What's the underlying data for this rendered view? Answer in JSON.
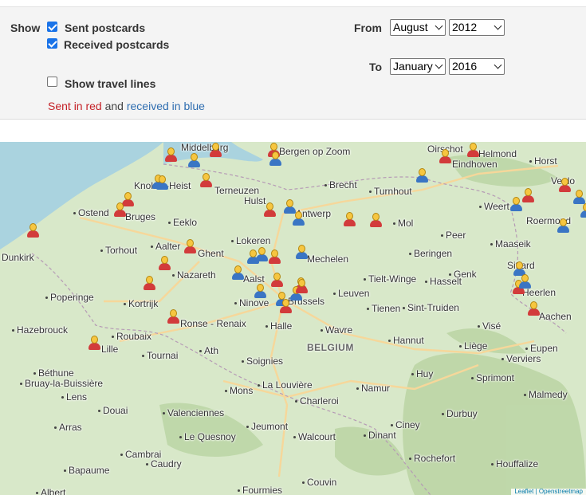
{
  "controls": {
    "show_label": "Show",
    "sent": {
      "label": "Sent postcards",
      "checked": true
    },
    "received": {
      "label": "Received postcards",
      "checked": true
    },
    "travel": {
      "label": "Show travel lines",
      "checked": false
    },
    "from_label": "From",
    "to_label": "To",
    "from_month": "August",
    "from_year": "2012",
    "to_month": "January",
    "to_year": "2016",
    "legend": {
      "sent": "Sent in red",
      "and": "and",
      "received": "received in blue"
    }
  },
  "map": {
    "colors": {
      "land": "#d8e8c9",
      "water": "#aad3df",
      "forest": "#bdd6a6",
      "road": "#f6d79a",
      "border": "#b59ab5"
    },
    "country_label": "BELGIUM",
    "attribution": "Leaflet | Openstreetmap",
    "places": [
      {
        "name": "Middelburg",
        "dot": false
      },
      {
        "name": "Bergen op Zoom",
        "dot": false
      },
      {
        "name": "Oirschot",
        "dot": false
      },
      {
        "name": "Helmond",
        "dot": false
      },
      {
        "name": "Eindhoven",
        "dot": false
      },
      {
        "name": "Horst",
        "dot": true
      },
      {
        "name": "Venlo",
        "dot": false
      },
      {
        "name": "Knokke-Heist",
        "dot": false
      },
      {
        "name": "Terneuzen",
        "dot": false
      },
      {
        "name": "Brecht",
        "dot": true
      },
      {
        "name": "Turnhout",
        "dot": true
      },
      {
        "name": "Hulst",
        "dot": false
      },
      {
        "name": "Weert",
        "dot": true
      },
      {
        "name": "Ostend",
        "dot": true
      },
      {
        "name": "Bruges",
        "dot": false
      },
      {
        "name": "Eeklo",
        "dot": true
      },
      {
        "name": "Antwerp",
        "dot": false
      },
      {
        "name": "Mol",
        "dot": true
      },
      {
        "name": "Roermond",
        "dot": false
      },
      {
        "name": "Dunkirk",
        "dot": false
      },
      {
        "name": "Aalter",
        "dot": true
      },
      {
        "name": "Lokeren",
        "dot": true
      },
      {
        "name": "Peer",
        "dot": true
      },
      {
        "name": "Maaseik",
        "dot": true
      },
      {
        "name": "Torhout",
        "dot": true
      },
      {
        "name": "Ghent",
        "dot": false
      },
      {
        "name": "Mechelen",
        "dot": false
      },
      {
        "name": "Beringen",
        "dot": true
      },
      {
        "name": "Sittard",
        "dot": false
      },
      {
        "name": "Nazareth",
        "dot": true
      },
      {
        "name": "Aalst",
        "dot": false
      },
      {
        "name": "Genk",
        "dot": true
      },
      {
        "name": "Tielt-Winge",
        "dot": true
      },
      {
        "name": "Hasselt",
        "dot": true
      },
      {
        "name": "Heerlen",
        "dot": false
      },
      {
        "name": "Poperinge",
        "dot": true
      },
      {
        "name": "Leuven",
        "dot": true
      },
      {
        "name": "Kortrijk",
        "dot": true
      },
      {
        "name": "Ninove",
        "dot": true
      },
      {
        "name": "Brussels",
        "dot": false
      },
      {
        "name": "Tienen",
        "dot": true
      },
      {
        "name": "Sint-Truiden",
        "dot": true
      },
      {
        "name": "Aachen",
        "dot": false
      },
      {
        "name": "Hazebrouck",
        "dot": true
      },
      {
        "name": "Roubaix",
        "dot": true
      },
      {
        "name": "Ronse - Renaix",
        "dot": false
      },
      {
        "name": "Halle",
        "dot": true
      },
      {
        "name": "Wavre",
        "dot": true
      },
      {
        "name": "Visé",
        "dot": true
      },
      {
        "name": "Lille",
        "dot": false
      },
      {
        "name": "Tournai",
        "dot": true
      },
      {
        "name": "Ath",
        "dot": true
      },
      {
        "name": "Hannut",
        "dot": true
      },
      {
        "name": "Liège",
        "dot": true
      },
      {
        "name": "Eupen",
        "dot": true
      },
      {
        "name": "Verviers",
        "dot": true
      },
      {
        "name": "Soignies",
        "dot": true
      },
      {
        "name": "Béthune",
        "dot": true
      },
      {
        "name": "Huy",
        "dot": true
      },
      {
        "name": "Sprimont",
        "dot": true
      },
      {
        "name": "Bruay-la-Buissière",
        "dot": true
      },
      {
        "name": "La Louvière",
        "dot": true
      },
      {
        "name": "Mons",
        "dot": true
      },
      {
        "name": "Namur",
        "dot": true
      },
      {
        "name": "Malmedy",
        "dot": true
      },
      {
        "name": "Lens",
        "dot": true
      },
      {
        "name": "Charleroi",
        "dot": true
      },
      {
        "name": "Douai",
        "dot": true
      },
      {
        "name": "Valenciennes",
        "dot": true
      },
      {
        "name": "Durbuy",
        "dot": true
      },
      {
        "name": "Jeumont",
        "dot": true
      },
      {
        "name": "Arras",
        "dot": true
      },
      {
        "name": "Ciney",
        "dot": true
      },
      {
        "name": "Le Quesnoy",
        "dot": true
      },
      {
        "name": "Walcourt",
        "dot": true
      },
      {
        "name": "Dinant",
        "dot": true
      },
      {
        "name": "Cambrai",
        "dot": true
      },
      {
        "name": "Rochefort",
        "dot": true
      },
      {
        "name": "Caudry",
        "dot": true
      },
      {
        "name": "Houffalize",
        "dot": true
      },
      {
        "name": "Bapaume",
        "dot": true
      },
      {
        "name": "Fourmies",
        "dot": true
      },
      {
        "name": "Couvin",
        "dot": true
      },
      {
        "name": "Albert",
        "dot": true
      }
    ],
    "markers": [
      "sent",
      "received",
      "sent",
      "sent",
      "received",
      "sent",
      "sent",
      "received",
      "sent",
      "received",
      "received",
      "sent",
      "sent",
      "sent",
      "received",
      "received",
      "sent",
      "sent",
      "received",
      "sent",
      "sent",
      "received",
      "received",
      "received",
      "sent",
      "sent",
      "sent",
      "received",
      "received",
      "sent",
      "received",
      "received",
      "sent",
      "sent",
      "received",
      "sent",
      "sent",
      "sent",
      "sent",
      "received",
      "sent",
      "sent",
      "received",
      "received",
      "received",
      "sent"
    ]
  }
}
